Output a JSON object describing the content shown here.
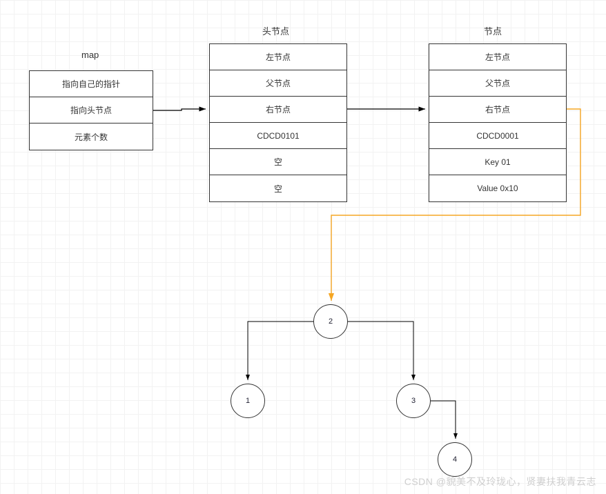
{
  "map": {
    "title": "map",
    "rows": [
      "指向自己的指针",
      "指向头节点",
      "元素个数"
    ]
  },
  "head_node": {
    "title": "头节点",
    "rows": [
      "左节点",
      "父节点",
      "右节点",
      "CDCD0101",
      "空",
      "空"
    ]
  },
  "node": {
    "title": "节点",
    "rows": [
      "左节点",
      "父节点",
      "右节点",
      "CDCD0001",
      "Key 01",
      "Value 0x10"
    ]
  },
  "tree": {
    "root": "2",
    "left": "1",
    "right": "3",
    "rr": "4"
  },
  "watermark": "CSDN @貌美不及玲珑心，贤妻扶我青云志"
}
